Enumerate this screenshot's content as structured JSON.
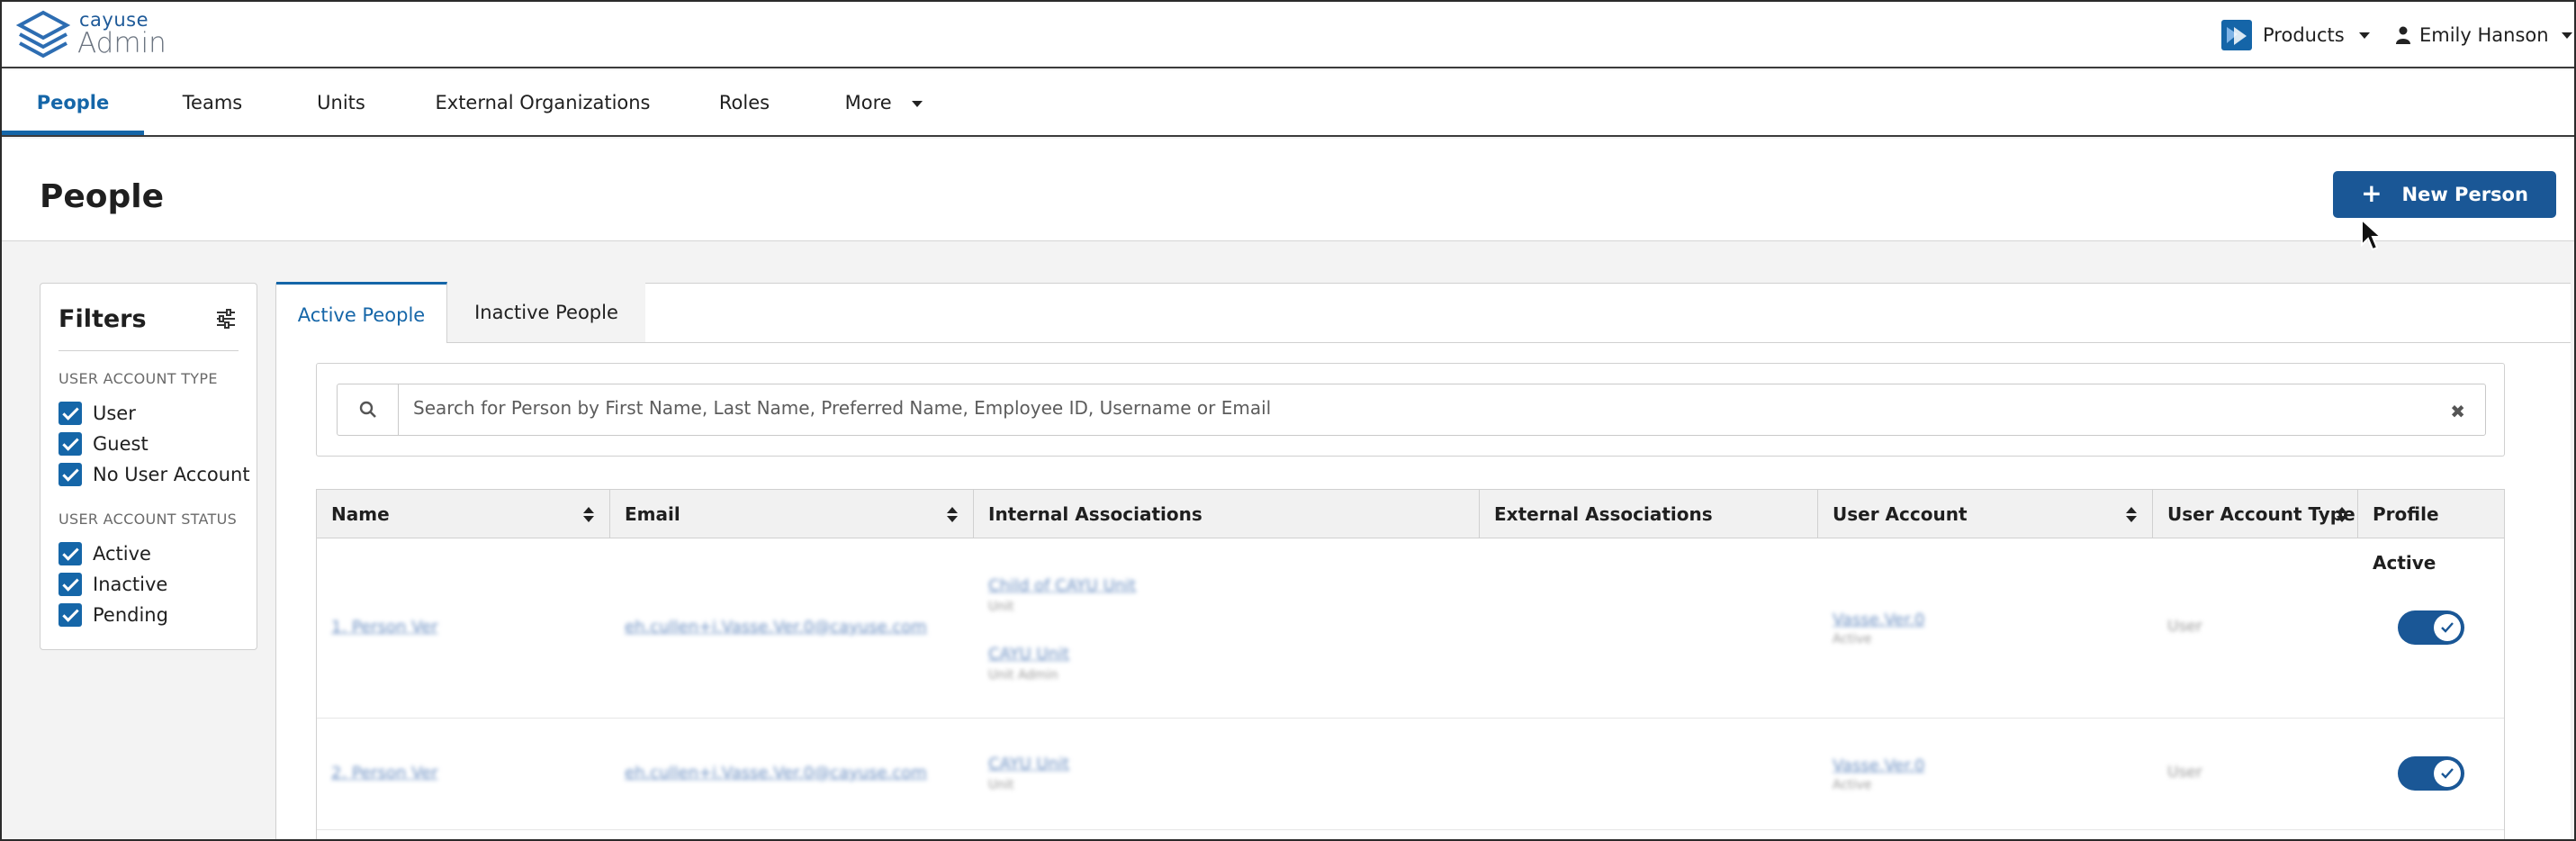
{
  "app": {
    "logo_small": "cayuse",
    "logo_big": "Admin",
    "products_label": "Products",
    "user_name": "Emily Hanson"
  },
  "nav": {
    "items": [
      {
        "label": "People",
        "active": true
      },
      {
        "label": "Teams"
      },
      {
        "label": "Units"
      },
      {
        "label": "External Organizations"
      },
      {
        "label": "Roles"
      },
      {
        "label": "More"
      }
    ]
  },
  "page": {
    "title": "People",
    "new_button_label": "New Person",
    "new_button_icon": "plus-icon"
  },
  "filters": {
    "title": "Filters",
    "group1_label": "USER ACCOUNT TYPE",
    "group1": [
      {
        "label": "User",
        "checked": true
      },
      {
        "label": "Guest",
        "checked": true
      },
      {
        "label": "No User Account",
        "checked": true
      }
    ],
    "group2_label": "USER ACCOUNT STATUS",
    "group2": [
      {
        "label": "Active",
        "checked": true
      },
      {
        "label": "Inactive",
        "checked": true
      },
      {
        "label": "Pending",
        "checked": true
      }
    ]
  },
  "tabs": {
    "active": "Active People",
    "inactive": "Inactive People"
  },
  "search": {
    "placeholder": "Search for Person by First Name, Last Name, Preferred Name, Employee ID, Username or Email"
  },
  "table": {
    "columns": [
      "Name",
      "Email",
      "Internal Associations",
      "External Associations",
      "User Account",
      "User Account Type",
      "Profile Active"
    ],
    "rows": [
      {
        "name": "1. Person Ver",
        "email": "eh.cullen+i.Vasse.Ver.0@cayuse.com",
        "internal": [
          {
            "link": "Child of CAYU Unit",
            "sub": "Unit"
          },
          {
            "link": "CAYU Unit",
            "sub": "Unit Admin"
          }
        ],
        "account_link": "Vasse.Ver.0",
        "account_sub": "Active",
        "account_type": "User",
        "profile_active": true
      },
      {
        "name": "2. Person Ver",
        "email": "eh.cullen+i.Vasse.Ver.0@cayuse.com",
        "internal": [
          {
            "link": "CAYU Unit",
            "sub": "Unit"
          }
        ],
        "account_link": "Vasse.Ver.0",
        "account_sub": "Active",
        "account_type": "User",
        "profile_active": true
      }
    ]
  },
  "colors": {
    "accent": "#1566a8",
    "button": "#1a5796"
  }
}
